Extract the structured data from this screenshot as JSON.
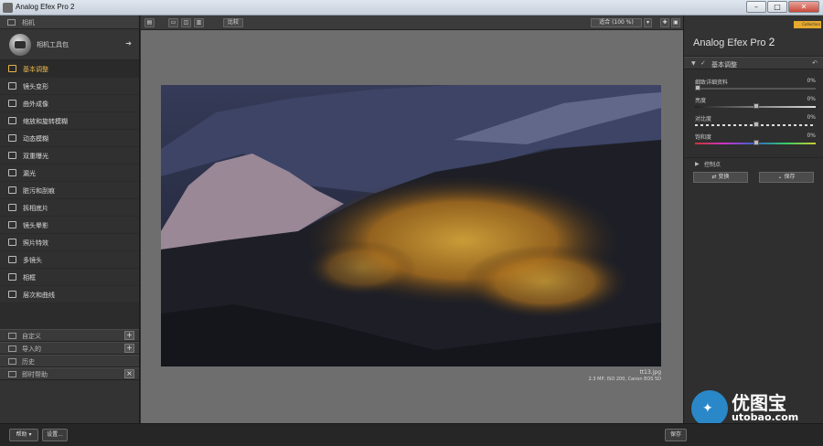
{
  "window": {
    "title": "Analog Efex Pro 2"
  },
  "left_panel": {
    "header": "相机",
    "toolkit": "相机工具包",
    "items": [
      {
        "label": "基本调整",
        "active": true
      },
      {
        "label": "镜头变形",
        "active": false
      },
      {
        "label": "曲外成像",
        "active": false
      },
      {
        "label": "缩放和旋转模糊",
        "active": false
      },
      {
        "label": "动态模糊",
        "active": false
      },
      {
        "label": "双重曝光",
        "active": false
      },
      {
        "label": "漏光",
        "active": false
      },
      {
        "label": "脏污和刮痕",
        "active": false
      },
      {
        "label": "拆相底片",
        "active": false
      },
      {
        "label": "镜头晕影",
        "active": false
      },
      {
        "label": "照片特效",
        "active": false
      },
      {
        "label": "多镜头",
        "active": false
      },
      {
        "label": "相框",
        "active": false
      },
      {
        "label": "层次和曲线",
        "active": false
      }
    ],
    "rows": [
      {
        "label": "自定义"
      },
      {
        "label": "导入的"
      },
      {
        "label": "历史"
      },
      {
        "label": "即时帮助"
      }
    ]
  },
  "toolbar": {
    "compare": "比较",
    "zoom": "适合 (100 %)"
  },
  "image": {
    "filename": "tt13.jpg",
    "meta": "2.3 MP, ISO 200, Canon EOS 5D"
  },
  "right_panel": {
    "brand": "Collection",
    "product_name": "Analog Efex Pro",
    "product_version": "2",
    "section": "基本调整",
    "sliders": [
      {
        "label": "细致详细资料",
        "value": "0%",
        "pos": 0.0
      },
      {
        "label": "亮度",
        "value": "0%",
        "pos": 0.5
      },
      {
        "label": "对比度",
        "value": "0%",
        "pos": 0.5
      },
      {
        "label": "饱和度",
        "value": "0%",
        "pos": 0.5
      }
    ],
    "control_points": "控制点",
    "buttons": {
      "change": "变换",
      "save": "保存"
    }
  },
  "bottom": {
    "help": "帮助",
    "settings": "设置...",
    "save_partial": "保存"
  },
  "watermark": {
    "text": "优图宝",
    "url": "utobao.com"
  }
}
